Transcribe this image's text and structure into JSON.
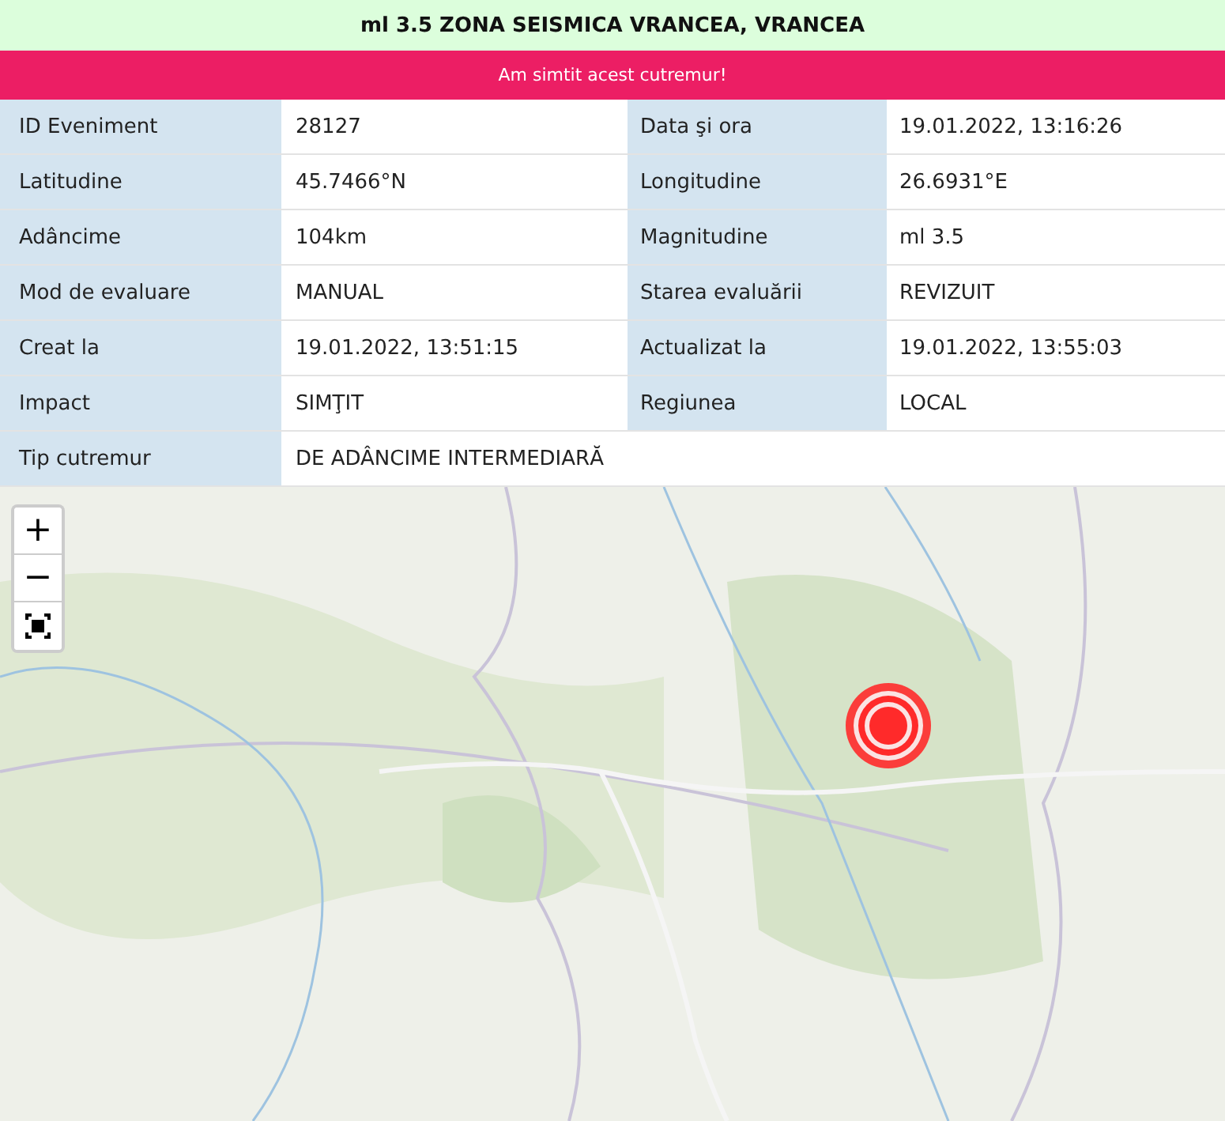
{
  "title": "ml 3.5 ZONA SEISMICA VRANCEA, VRANCEA",
  "felt_button": "Am simtit acest cutremur!",
  "details": [
    {
      "label": "ID Eveniment",
      "value": "28127",
      "label_2": "Data şi ora",
      "value_2": "19.01.2022, 13:16:26"
    },
    {
      "label": "Latitudine",
      "value": "45.7466°N",
      "label_2": "Longitudine",
      "value_2": "26.6931°E"
    },
    {
      "label": "Adâncime",
      "value": "104km",
      "label_2": "Magnitudine",
      "value_2": "ml 3.5"
    },
    {
      "label": "Mod de evaluare",
      "value": "MANUAL",
      "label_2": "Starea evaluării",
      "value_2": "REVIZUIT"
    },
    {
      "label": "Creat la",
      "value": "19.01.2022, 13:51:15",
      "label_2": "Actualizat la",
      "value_2": "19.01.2022, 13:55:03"
    },
    {
      "label": "Impact",
      "value": "SIMŢIT",
      "label_2": "Regiunea",
      "value_2": "LOCAL"
    },
    {
      "label": "Tip cutremur",
      "value": "DE ADÂNCIME INTERMEDIARĂ"
    }
  ],
  "map": {
    "zoom_in": "+",
    "zoom_out": "−"
  }
}
